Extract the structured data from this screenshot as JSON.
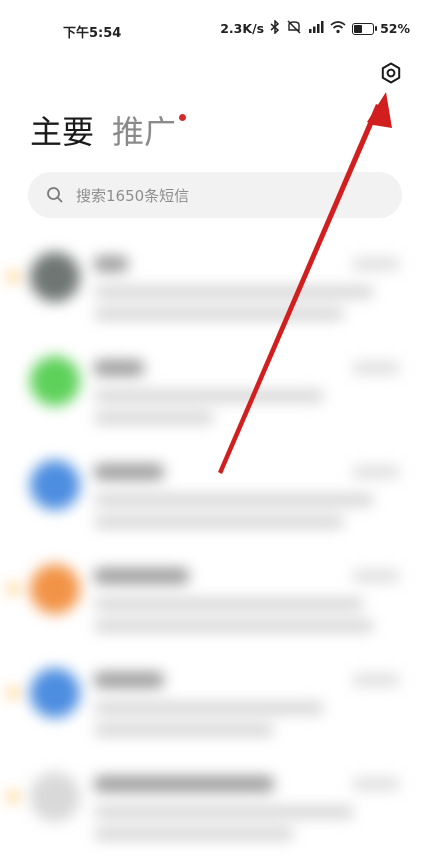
{
  "status_bar": {
    "time": "下午5:54",
    "net_speed": "2.3K/s",
    "battery": "52%",
    "battery_level": 0.52,
    "icons": [
      "bluetooth-icon",
      "mute-icon",
      "signal-icon",
      "wifi-icon",
      "battery-icon"
    ]
  },
  "header": {
    "settings_icon": "gear-icon"
  },
  "tabs": [
    {
      "label": "主要",
      "active": true
    },
    {
      "label": "推广",
      "active": false,
      "has_badge": true
    }
  ],
  "search": {
    "placeholder": "搜索1650条短信",
    "icon": "search-icon"
  },
  "conversations": [
    {
      "avatar_color": "#6f7673",
      "unread": true
    },
    {
      "avatar_color": "#5ed15a",
      "unread": false
    },
    {
      "avatar_color": "#4d8ee0",
      "unread": false
    },
    {
      "avatar_color": "#f29447",
      "unread": true
    },
    {
      "avatar_color": "#4d8ee0",
      "unread": true
    },
    {
      "avatar_color": "#d9d9d9",
      "unread": true
    }
  ],
  "colors": {
    "arrow": "#d11f1f",
    "badge": "#d22b2b",
    "unread_dot": "#ffb640"
  }
}
